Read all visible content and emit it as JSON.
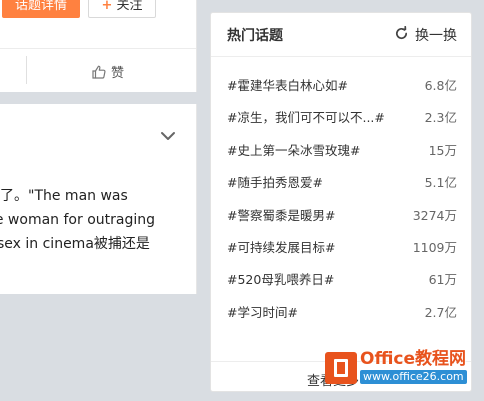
{
  "feed": {
    "topic_detail_button": "话题详情",
    "follow_button": "关注",
    "like_label": "赞",
    "post_lines": [
      "了。\"The man was",
      "he woman for outraging",
      "sex in cinema被捕还是"
    ]
  },
  "hot_topics": {
    "title": "热门话题",
    "refresh_label": "换一换",
    "items": [
      {
        "name": "#霍建华表白林心如#",
        "count": "6.8亿"
      },
      {
        "name": "#凉生，我们可不可以不...#",
        "count": "2.3亿"
      },
      {
        "name": "#史上第一朵冰雪玫瑰#",
        "count": "15万"
      },
      {
        "name": "#随手拍秀恩爱#",
        "count": "5.1亿"
      },
      {
        "name": "#警察蜀黍是暖男#",
        "count": "3274万"
      },
      {
        "name": "#可持续发展目标#",
        "count": "1109万"
      },
      {
        "name": "#520母乳喂养日#",
        "count": "61万"
      },
      {
        "name": "#学习时间#",
        "count": "2.7亿"
      }
    ],
    "more_label": "查看更多"
  },
  "watermark": {
    "brand": "Office教程网",
    "url": "www.office26.com"
  },
  "icons": {
    "like": "thumbs-up-icon",
    "collapse": "chevron-down-icon",
    "refresh": "refresh-icon",
    "office": "office-logo-icon"
  },
  "colors": {
    "accent_orange": "#ff8140",
    "watermark_orange": "#e8531d",
    "watermark_blue": "#2d8fd5"
  }
}
